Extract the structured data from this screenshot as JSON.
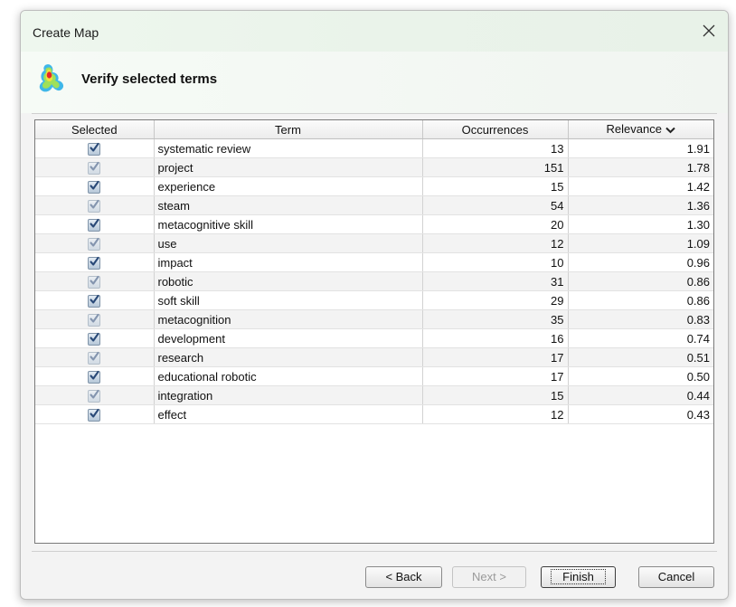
{
  "window": {
    "title": "Create Map"
  },
  "header": {
    "title": "Verify selected terms"
  },
  "table": {
    "columns": [
      "Selected",
      "Term",
      "Occurrences",
      "Relevance"
    ],
    "sort": {
      "column": "Relevance",
      "direction": "descending"
    },
    "rows": [
      {
        "selected": true,
        "term": "systematic review",
        "occurrences": "13",
        "relevance": "1.91"
      },
      {
        "selected": true,
        "term": "project",
        "occurrences": "151",
        "relevance": "1.78"
      },
      {
        "selected": true,
        "term": "experience",
        "occurrences": "15",
        "relevance": "1.42"
      },
      {
        "selected": true,
        "term": "steam",
        "occurrences": "54",
        "relevance": "1.36"
      },
      {
        "selected": true,
        "term": "metacognitive skill",
        "occurrences": "20",
        "relevance": "1.30"
      },
      {
        "selected": true,
        "term": "use",
        "occurrences": "12",
        "relevance": "1.09"
      },
      {
        "selected": true,
        "term": "impact",
        "occurrences": "10",
        "relevance": "0.96"
      },
      {
        "selected": true,
        "term": "robotic",
        "occurrences": "31",
        "relevance": "0.86"
      },
      {
        "selected": true,
        "term": "soft skill",
        "occurrences": "29",
        "relevance": "0.86"
      },
      {
        "selected": true,
        "term": "metacognition",
        "occurrences": "35",
        "relevance": "0.83"
      },
      {
        "selected": true,
        "term": "development",
        "occurrences": "16",
        "relevance": "0.74"
      },
      {
        "selected": true,
        "term": "research",
        "occurrences": "17",
        "relevance": "0.51"
      },
      {
        "selected": true,
        "term": "educational robotic",
        "occurrences": "17",
        "relevance": "0.50"
      },
      {
        "selected": true,
        "term": "integration",
        "occurrences": "15",
        "relevance": "0.44"
      },
      {
        "selected": true,
        "term": "effect",
        "occurrences": "12",
        "relevance": "0.43"
      }
    ]
  },
  "buttons": {
    "back": "< Back",
    "next": "Next >",
    "finish": "Finish",
    "cancel": "Cancel"
  },
  "icons": {
    "close": "close-icon",
    "app": "vosviewer-map-icon",
    "sort": "chevron-down-icon",
    "checkbox": "checkbox-checked-icon"
  },
  "colors": {
    "titlebar": "#eef7ee",
    "checkbox_mark": "#2a4a78"
  }
}
